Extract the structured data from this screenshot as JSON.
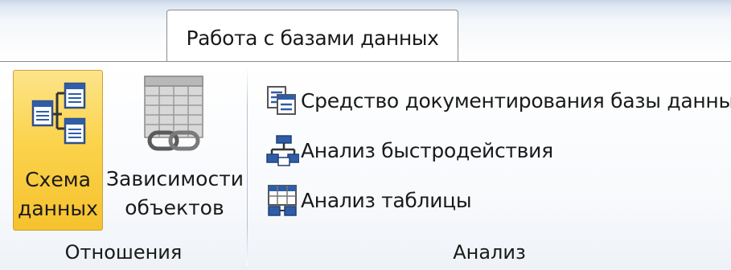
{
  "ribbon": {
    "active_tab": "Работа с базами данных",
    "groups": {
      "relations": {
        "label": "Отношения",
        "schema_button": {
          "line1": "Схема",
          "line2": "данных",
          "icon": "database-schema-icon"
        },
        "dependencies_button": {
          "line1": "Зависимости",
          "line2": "объектов",
          "icon": "object-dependencies-icon"
        }
      },
      "analysis": {
        "label": "Анализ",
        "items": [
          {
            "label": "Средство документирования базы данных",
            "icon": "documenter-icon"
          },
          {
            "label": "Анализ быстродействия",
            "icon": "performance-analyzer-icon"
          },
          {
            "label": "Анализ таблицы",
            "icon": "table-analyzer-icon"
          }
        ]
      }
    }
  },
  "colors": {
    "highlight": "#fbd34c",
    "border": "#8c8c8c",
    "icon_blue": "#2f5da8"
  }
}
